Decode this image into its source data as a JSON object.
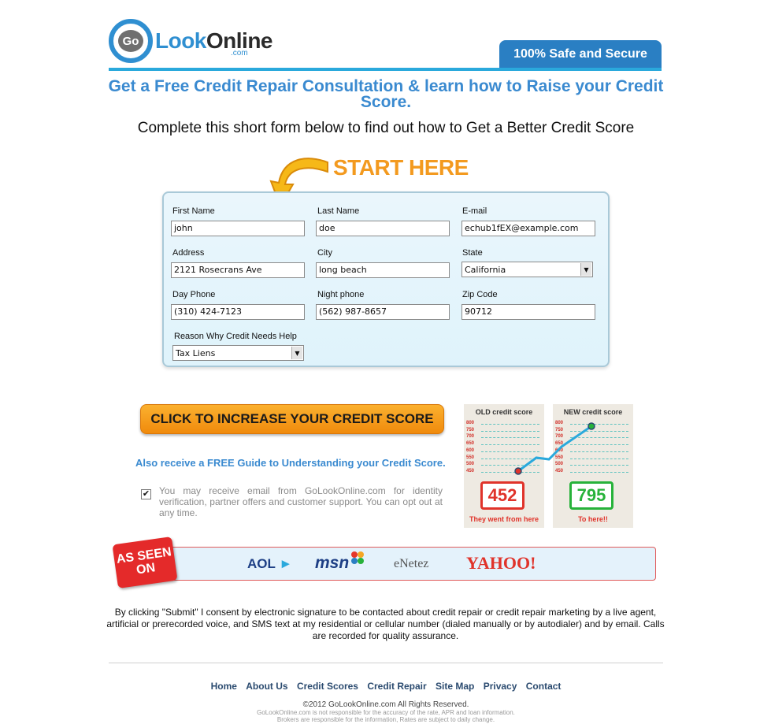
{
  "header": {
    "logo_go": "Go",
    "logo_look": "Look",
    "logo_online": "Online",
    "logo_com": ".com",
    "safe_badge": "100% Safe and Secure"
  },
  "headline": "Get a Free Credit Repair Consultation & learn how to Raise your Credit Score.",
  "subheadline": "Complete this short form below to find out how to Get a Better Credit Score",
  "start_here": "START HERE",
  "form": {
    "first_name": {
      "label": "First Name",
      "value": "john"
    },
    "last_name": {
      "label": "Last Name",
      "value": "doe"
    },
    "email": {
      "label": "E-mail",
      "value": "echub1fEX@example.com"
    },
    "address": {
      "label": "Address",
      "value": "2121 Rosecrans Ave"
    },
    "city": {
      "label": "City",
      "value": "long beach"
    },
    "state": {
      "label": "State",
      "value": "California"
    },
    "day_phone": {
      "label": "Day Phone",
      "value": "(310) 424-7123"
    },
    "night_phone": {
      "label": "Night phone",
      "value": "(562) 987-8657"
    },
    "zip": {
      "label": "Zip Code",
      "value": "90712"
    },
    "reason": {
      "label": "Reason Why Credit Needs Help",
      "value": "Tax Liens"
    }
  },
  "cta_label": "CLICK TO INCREASE YOUR CREDIT SCORE",
  "guide_text": "Also receive a FREE Guide to Understanding your Credit Score.",
  "optin": {
    "checked": true,
    "text": "You may receive email from GoLookOnline.com for identity verification, partner offers and customer support. You can opt out at any time."
  },
  "scores": {
    "old": {
      "title": "OLD credit score",
      "value": "452",
      "caption": "They went from here",
      "color": "#e0332a"
    },
    "new": {
      "title": "NEW credit score",
      "value": "795",
      "caption": "To here!!",
      "color": "#27b23a"
    },
    "ticks": [
      "800",
      "750",
      "700",
      "650",
      "600",
      "550",
      "500",
      "450"
    ]
  },
  "as_seen_on": {
    "badge": "AS SEEN ON",
    "badge_line1": "AS SEEN",
    "badge_line2": "ON",
    "logos": [
      "AOL",
      "msn",
      "eNetez",
      "YAHOO!"
    ]
  },
  "consent_text": "By clicking \"Submit\" I consent by electronic signature to be contacted about credit repair or credit repair marketing by a live agent, artificial or prerecorded voice, and SMS text at my residential or cellular number (dialed manually or by autodialer) and by email. Calls are recorded for quality assurance.",
  "footer": {
    "links": [
      "Home",
      "About Us",
      "Credit Scores",
      "Credit Repair",
      "Site Map",
      "Privacy",
      "Contact"
    ],
    "copyright": "©2012 GoLookOnline.com All Rights Reserved.",
    "disclaimer_1": "GoLookOnline.com is not responsible for the accuracy of the rate, APR and loan information.",
    "disclaimer_2": "Brokers are responsible for the information, Rates are subject to daily change."
  }
}
